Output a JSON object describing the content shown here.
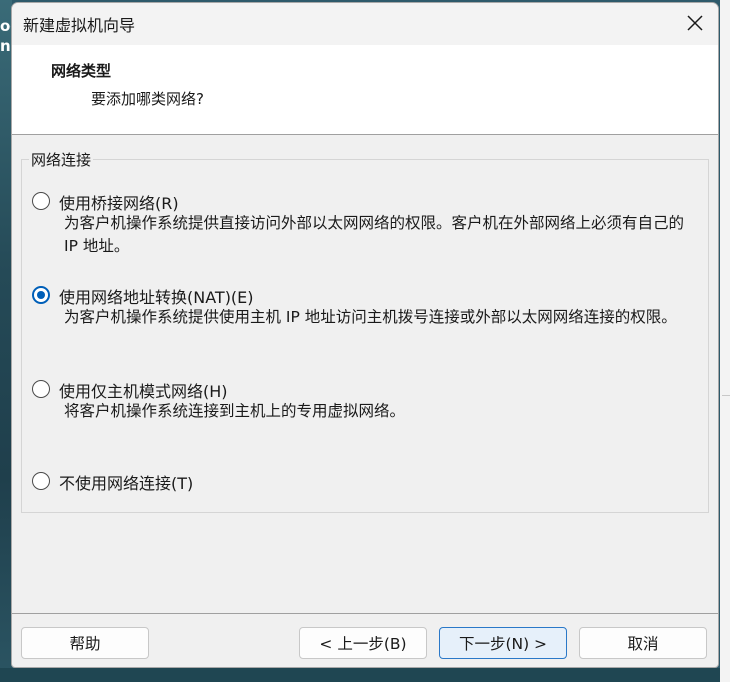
{
  "window": {
    "title": "新建虚拟机向导"
  },
  "header": {
    "title": "网络类型",
    "subtitle": "要添加哪类网络?"
  },
  "background": {
    "edge_text": "oc\nn"
  },
  "group": {
    "label": "网络连接"
  },
  "options": [
    {
      "label": "使用桥接网络(R)",
      "desc": "为客户机操作系统提供直接访问外部以太网网络的权限。客户机在外部网络上必须有自己的 IP 地址。",
      "checked": false
    },
    {
      "label": "使用网络地址转换(NAT)(E)",
      "desc": "为客户机操作系统提供使用主机 IP 地址访问主机拨号连接或外部以太网网络连接的权限。",
      "checked": true
    },
    {
      "label": "使用仅主机模式网络(H)",
      "desc": "将客户机操作系统连接到主机上的专用虚拟网络。",
      "checked": false
    },
    {
      "label": "不使用网络连接(T)",
      "desc": "",
      "checked": false
    }
  ],
  "buttons": {
    "help": "帮助",
    "back": "< 上一步(B)",
    "next": "下一步(N) >",
    "cancel": "取消"
  },
  "colors": {
    "accent": "#005fb8",
    "dialog_bg": "#f0f0f0",
    "header_bg": "#ffffff"
  }
}
